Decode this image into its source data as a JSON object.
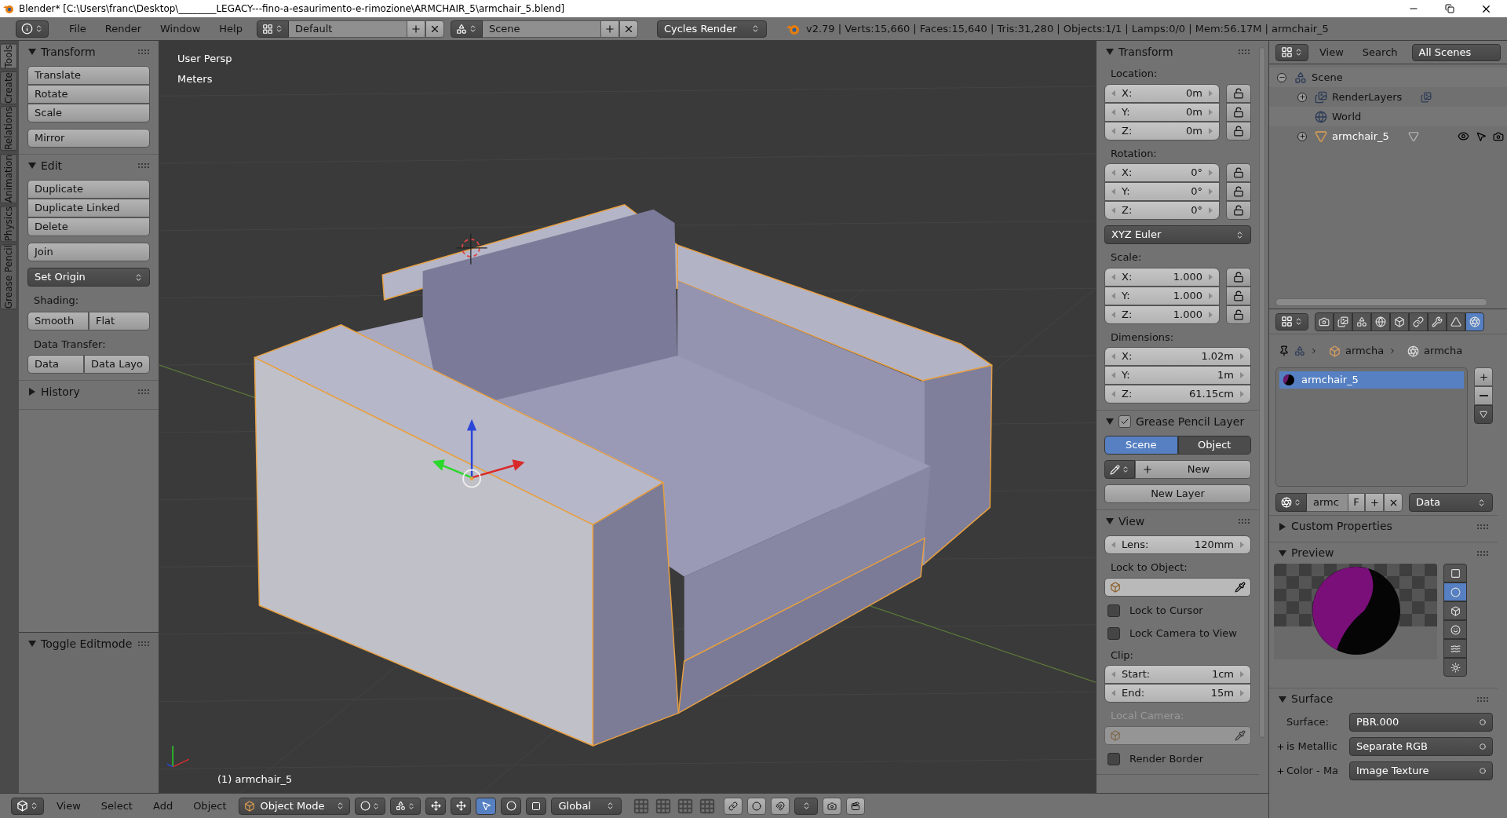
{
  "title_bar": {
    "title": "Blender* [C:\\Users\\franc\\Desktop\\________LEGACY---fino-a-esaurimento-e-rimozione\\ARMCHAIR_5\\armchair_5.blend]"
  },
  "top_header": {
    "menus": [
      "File",
      "Render",
      "Window",
      "Help"
    ],
    "screen_layout": "Default",
    "scene": "Scene",
    "render_engine": "Cycles Render",
    "stats": "v2.79 | Verts:15,660 | Faces:15,640 | Tris:31,280 | Objects:1/1 | Lamps:0/0 | Mem:56.17M | armchair_5"
  },
  "tool_tabs": [
    {
      "label": "Tools",
      "selected": true
    },
    {
      "label": "Create",
      "selected": false
    },
    {
      "label": "Relations",
      "selected": false
    },
    {
      "label": "Animation",
      "selected": false
    },
    {
      "label": "Physics",
      "selected": false
    },
    {
      "label": "Grease Pencil",
      "selected": false
    }
  ],
  "tool_shelf": {
    "panels": [
      {
        "title": "Transform",
        "expanded": true,
        "items": [
          {
            "kind": "group",
            "buttons": [
              "Translate",
              "Rotate",
              "Scale"
            ]
          },
          {
            "kind": "group",
            "buttons": [
              "Mirror"
            ]
          }
        ]
      },
      {
        "title": "Edit",
        "expanded": true,
        "items": [
          {
            "kind": "group",
            "buttons": [
              "Duplicate",
              "Duplicate Linked",
              "Delete"
            ]
          },
          {
            "kind": "group",
            "buttons": [
              "Join"
            ]
          },
          {
            "kind": "dropdown",
            "value": "Set Origin"
          },
          {
            "kind": "label",
            "text": "Shading:"
          },
          {
            "kind": "row",
            "buttons": [
              "Smooth",
              "Flat"
            ]
          },
          {
            "kind": "label",
            "text": "Data Transfer:"
          },
          {
            "kind": "row",
            "buttons": [
              "Data",
              "Data Layo"
            ]
          }
        ]
      },
      {
        "title": "History",
        "expanded": false
      }
    ]
  },
  "operator_panel": {
    "title": "Toggle Editmode",
    "expanded": true
  },
  "viewport": {
    "view_name": "User Persp",
    "units": "Meters",
    "object_label": "(1) armchair_5"
  },
  "n_panel": {
    "panels": [
      {
        "title": "Transform",
        "expanded": true,
        "rows": [
          {
            "kind": "label",
            "text": "Location:",
            "disabled": false
          },
          {
            "kind": "vector",
            "locks": true,
            "fields": [
              {
                "label": "X:",
                "value": "0m"
              },
              {
                "label": "Y:",
                "value": "0m"
              },
              {
                "label": "Z:",
                "value": "0m"
              }
            ]
          },
          {
            "kind": "label",
            "text": "Rotation:",
            "disabled": false
          },
          {
            "kind": "vector",
            "locks": true,
            "fields": [
              {
                "label": "X:",
                "value": "0°"
              },
              {
                "label": "Y:",
                "value": "0°"
              },
              {
                "label": "Z:",
                "value": "0°"
              }
            ]
          },
          {
            "kind": "dropdown",
            "value": "XYZ Euler"
          },
          {
            "kind": "label",
            "text": "Scale:",
            "disabled": false
          },
          {
            "kind": "vector",
            "locks": true,
            "fields": [
              {
                "label": "X:",
                "value": "1.000"
              },
              {
                "label": "Y:",
                "value": "1.000"
              },
              {
                "label": "Z:",
                "value": "1.000"
              }
            ]
          },
          {
            "kind": "label",
            "text": "Dimensions:",
            "disabled": false
          },
          {
            "kind": "vector",
            "locks": false,
            "fields": [
              {
                "label": "X:",
                "value": "1.02m"
              },
              {
                "label": "Y:",
                "value": "1m"
              },
              {
                "label": "Z:",
                "value": "61.15cm"
              }
            ]
          }
        ]
      },
      {
        "title": "Grease Pencil Layer",
        "expanded": true,
        "checked": true,
        "rows": [
          {
            "kind": "tabs",
            "tabs": [
              {
                "label": "Scene",
                "selected": true
              },
              {
                "label": "Object",
                "selected": false
              }
            ]
          },
          {
            "kind": "new",
            "value": "New"
          },
          {
            "kind": "button",
            "value": "New Layer"
          }
        ]
      },
      {
        "title": "View",
        "expanded": true,
        "rows": [
          {
            "kind": "vector",
            "locks": false,
            "fields": [
              {
                "label": "Lens:",
                "value": "120mm"
              }
            ]
          },
          {
            "kind": "label",
            "text": "Lock to Object:",
            "disabled": false
          },
          {
            "kind": "object_field",
            "disabled": false
          },
          {
            "kind": "checkbox",
            "label": "Lock to Cursor",
            "checked": false
          },
          {
            "kind": "checkbox",
            "label": "Lock Camera to View",
            "checked": false
          },
          {
            "kind": "label",
            "text": "Clip:",
            "disabled": false
          },
          {
            "kind": "vector",
            "locks": false,
            "fields": [
              {
                "label": "Start:",
                "value": "1cm"
              },
              {
                "label": "End:",
                "value": "15m"
              }
            ]
          },
          {
            "kind": "label",
            "text": "Local Camera:",
            "disabled": true
          },
          {
            "kind": "object_field",
            "disabled": true
          },
          {
            "kind": "checkbox",
            "label": "Render Border",
            "checked": false
          }
        ]
      }
    ]
  },
  "outliner": {
    "menus": [
      "View",
      "Search"
    ],
    "filter": "All Scenes",
    "tree": [
      {
        "name": "Scene",
        "kind": "scene",
        "expanded": true,
        "selected": false,
        "children": [
          {
            "name": "RenderLayers",
            "kind": "render_layers",
            "expanded": false,
            "selected": false
          },
          {
            "name": "World",
            "kind": "world",
            "selected": false
          },
          {
            "name": "armchair_5",
            "kind": "mesh_object",
            "expanded": false,
            "selected": true
          }
        ]
      }
    ]
  },
  "properties": {
    "context_tabs": [
      {
        "kind": "render",
        "selected": false
      },
      {
        "kind": "render_layers",
        "selected": false
      },
      {
        "kind": "scene",
        "selected": false
      },
      {
        "kind": "world",
        "selected": false
      },
      {
        "kind": "object",
        "selected": false
      },
      {
        "kind": "constraints",
        "selected": false
      },
      {
        "kind": "modifiers",
        "selected": false
      },
      {
        "kind": "data",
        "selected": false
      },
      {
        "kind": "material",
        "selected": true
      }
    ],
    "breadcrumb": [
      "armcha",
      "armcha"
    ],
    "material_slots": [
      {
        "name": "armchair_5",
        "selected": true
      }
    ],
    "datablock": {
      "name": "armc",
      "fake_user": "F",
      "link": "Data"
    },
    "panels": [
      {
        "title": "Custom Properties",
        "expanded": false
      },
      {
        "title": "Preview",
        "kind": "preview",
        "expanded": true,
        "shapes": [
          {
            "kind": "flat",
            "selected": false
          },
          {
            "kind": "sphere",
            "selected": true
          },
          {
            "kind": "cube",
            "selected": false
          },
          {
            "kind": "monkey",
            "selected": false
          },
          {
            "kind": "hair",
            "selected": false
          },
          {
            "kind": "sky",
            "selected": false
          }
        ]
      },
      {
        "title": "Surface",
        "kind": "surface",
        "expanded": true,
        "rows": [
          {
            "label": "Surface:",
            "value": "PBR.000",
            "expandable": false
          },
          {
            "label": "is Metallic",
            "value": "Separate RGB",
            "expandable": true
          },
          {
            "label": "Color - Ma",
            "value": "Image Texture",
            "expandable": true
          }
        ]
      }
    ]
  },
  "bottom_header": {
    "menus": [
      "View",
      "Select",
      "Add",
      "Object"
    ],
    "mode": "Object Mode",
    "orientation": "Global"
  }
}
